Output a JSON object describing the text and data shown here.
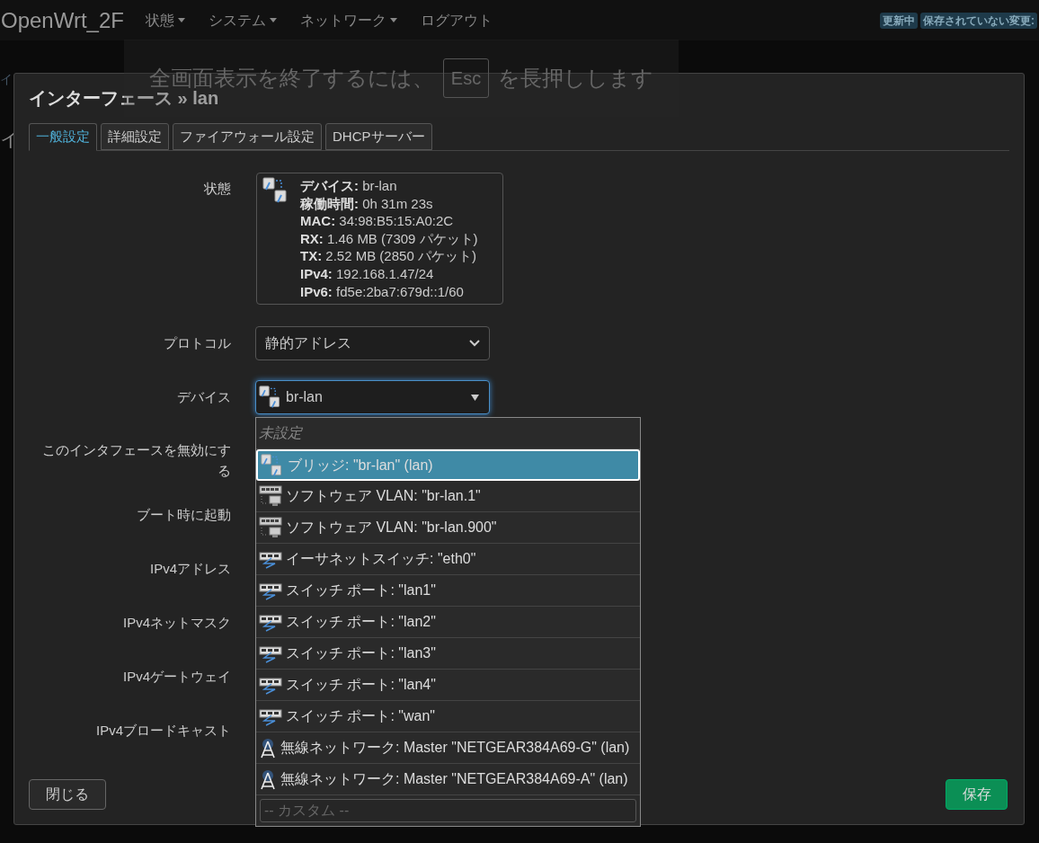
{
  "header": {
    "brand": "OpenWrt_2F",
    "menus": [
      {
        "label": "状態",
        "dropdown": true
      },
      {
        "label": "システム",
        "dropdown": true
      },
      {
        "label": "ネットワーク",
        "dropdown": true
      },
      {
        "label": "ログアウト",
        "dropdown": false
      }
    ],
    "badges": [
      "更新中",
      "保存されていない変更:"
    ]
  },
  "background_fragments": [
    "イ",
    "イ"
  ],
  "fullscreen_notice": {
    "before": "全画面表示を終了するには、",
    "key": "Esc",
    "after": "を長押しします"
  },
  "dialog": {
    "title": "インターフェース » lan",
    "tabs": [
      {
        "label": "一般設定",
        "selected": true
      },
      {
        "label": "詳細設定",
        "selected": false
      },
      {
        "label": "ファイアウォール設定",
        "selected": false
      },
      {
        "label": "DHCPサーバー",
        "selected": false
      }
    ],
    "status": {
      "label": "状態",
      "lines": [
        {
          "key": "デバイス:",
          "value": "br-lan"
        },
        {
          "key": "稼働時間:",
          "value": "0h 31m 23s"
        },
        {
          "key": "MAC:",
          "value": "34:98:B5:15:A0:2C"
        },
        {
          "key": "RX:",
          "value": "1.46 MB (7309 パケット)"
        },
        {
          "key": "TX:",
          "value": "2.52 MB (2850 パケット)"
        },
        {
          "key": "IPv4:",
          "value": "192.168.1.47/24"
        },
        {
          "key": "IPv6:",
          "value": "fd5e:2ba7:679d::1/60"
        }
      ]
    },
    "protocol": {
      "label": "プロトコル",
      "value": "静的アドレス"
    },
    "device": {
      "label": "デバイス",
      "value": "br-lan"
    },
    "other_labels": [
      "このインタフェースを無効にする",
      "ブート時に起動",
      "IPv4アドレス",
      "IPv4ネットマスク",
      "IPv4ゲートウェイ",
      "IPv4ブロードキャスト"
    ],
    "device_options": {
      "items": [
        {
          "kind": "none",
          "label": "未設定",
          "selected": false
        },
        {
          "kind": "bridge",
          "label": "ブリッジ: \"br-lan\" (lan)",
          "selected": true
        },
        {
          "kind": "vlan",
          "label": "ソフトウェア VLAN: \"br-lan.1\"",
          "selected": false
        },
        {
          "kind": "vlan",
          "label": "ソフトウェア VLAN: \"br-lan.900\"",
          "selected": false
        },
        {
          "kind": "switch",
          "label": "イーサネットスイッチ: \"eth0\"",
          "selected": false
        },
        {
          "kind": "switch",
          "label": "スイッチ ポート: \"lan1\"",
          "selected": false
        },
        {
          "kind": "switch",
          "label": "スイッチ ポート: \"lan2\"",
          "selected": false
        },
        {
          "kind": "switch",
          "label": "スイッチ ポート: \"lan3\"",
          "selected": false
        },
        {
          "kind": "switch",
          "label": "スイッチ ポート: \"lan4\"",
          "selected": false
        },
        {
          "kind": "switch",
          "label": "スイッチ ポート: \"wan\"",
          "selected": false
        },
        {
          "kind": "wifi",
          "label": "無線ネットワーク: Master \"NETGEAR384A69-G\" (lan)",
          "selected": false
        },
        {
          "kind": "wifi",
          "label": "無線ネットワーク: Master \"NETGEAR384A69-A\" (lan)",
          "selected": false
        }
      ],
      "custom_placeholder": "-- カスタム --"
    },
    "buttons": {
      "close": "閉じる",
      "save": "保存"
    }
  }
}
